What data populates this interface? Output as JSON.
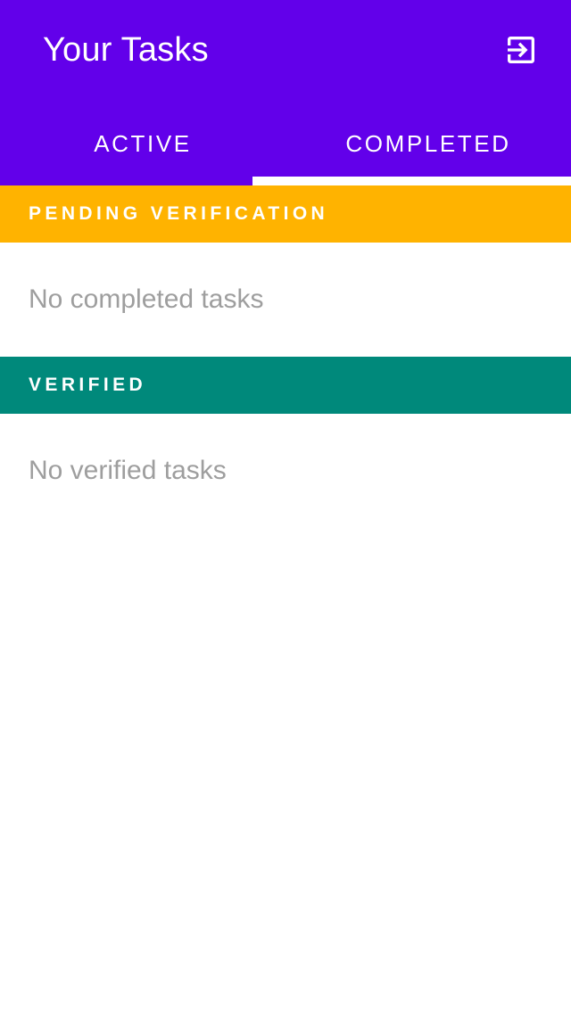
{
  "header": {
    "title": "Your Tasks",
    "logout_icon": "exit-to-app-icon",
    "background_color": "#6200EA"
  },
  "tabs": [
    {
      "label": "ACTIVE",
      "selected": false
    },
    {
      "label": "COMPLETED",
      "selected": true
    }
  ],
  "sections": {
    "pending": {
      "label": "PENDING VERIFICATION",
      "color": "#FFB300",
      "empty_text": "No completed tasks"
    },
    "verified": {
      "label": "VERIFIED",
      "color": "#00897B",
      "empty_text": "No verified tasks"
    }
  }
}
